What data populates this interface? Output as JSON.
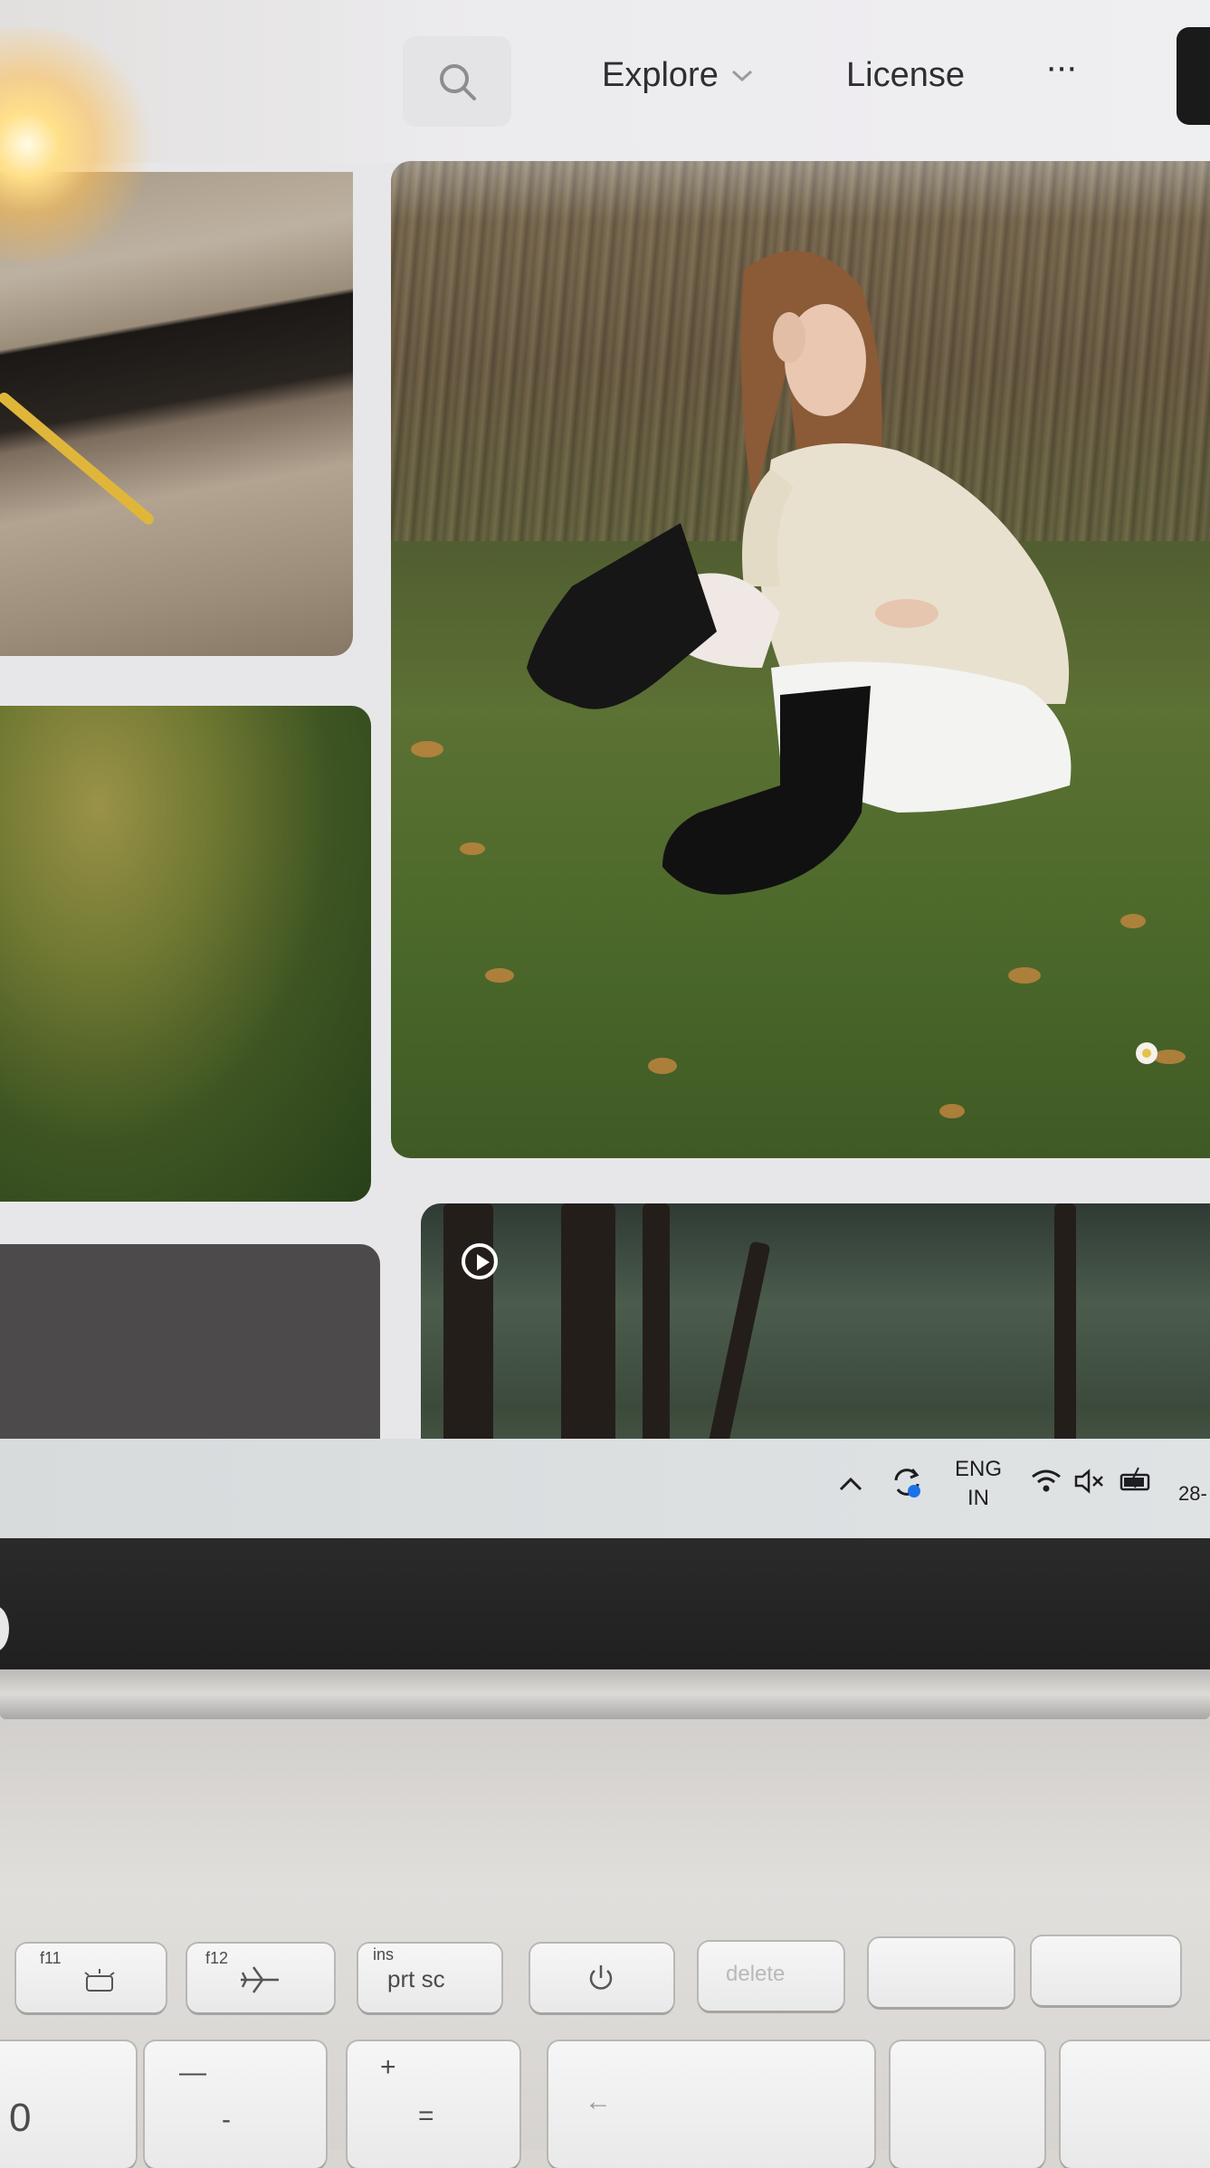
{
  "header": {
    "nav_explore": "Explore",
    "nav_license": "License",
    "more_label": "···"
  },
  "taskbar": {
    "lang_top": "ENG",
    "lang_bottom": "IN",
    "date_partial": "28-"
  },
  "keyboard": {
    "f11_label": "f11",
    "f12_label": "f12",
    "ins_label": "ins",
    "prtsc_label": "prt sc",
    "delete_label": "delete",
    "minus_top": "—",
    "minus_bottom": "-",
    "plus_top": "+",
    "equals_bottom": "=",
    "backspace_arrow": "←",
    "zero_label": "0"
  },
  "colors": {
    "accent_dark": "#1a1a1a",
    "screen_bg": "#e7e7e9"
  }
}
